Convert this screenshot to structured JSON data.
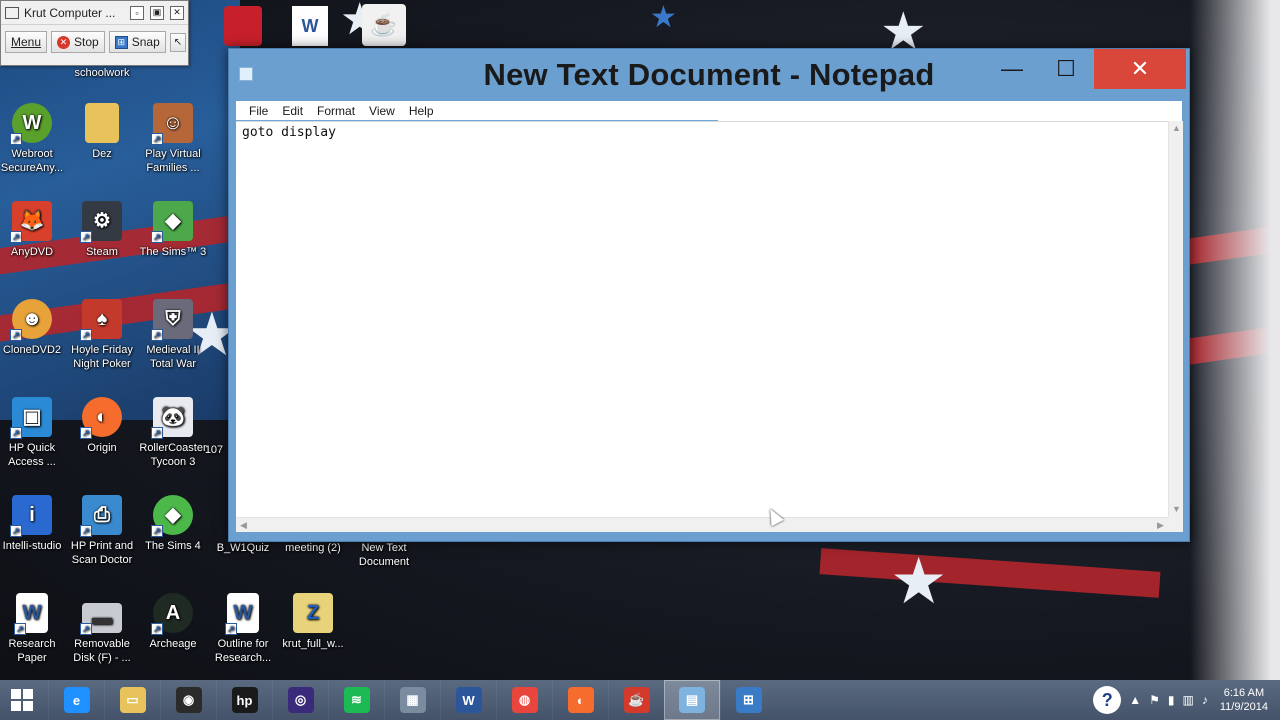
{
  "krut": {
    "title": "Krut Computer ...",
    "menu_label": "Menu",
    "stop_label": "Stop",
    "snap_label": "Snap"
  },
  "desktop_icons": [
    {
      "label": "schoolwork",
      "icon": "folder-icon"
    },
    {
      "label": "Webroot SecureAny...",
      "icon": "webroot-icon"
    },
    {
      "label": "Dez",
      "icon": "folder-icon"
    },
    {
      "label": "Play Virtual Families ...",
      "icon": "virtual-families-icon"
    },
    {
      "label": "AnyDVD",
      "icon": "anydvd-icon"
    },
    {
      "label": "Steam",
      "icon": "steam-icon"
    },
    {
      "label": "The Sims™ 3",
      "icon": "sims3-icon"
    },
    {
      "label": "CloneDVD2",
      "icon": "clonedvd-icon"
    },
    {
      "label": "Hoyle Friday Night Poker",
      "icon": "hoyle-poker-icon"
    },
    {
      "label": "Medieval II Total War",
      "icon": "medieval-icon"
    },
    {
      "label": "HP Quick Access ...",
      "icon": "hp-quick-access-icon"
    },
    {
      "label": "Origin",
      "icon": "origin-icon"
    },
    {
      "label": "RollerCoaster Tycoon 3",
      "icon": "rollercoaster-icon"
    },
    {
      "label": "107",
      "icon": "partial-icon"
    },
    {
      "label": "Intelli-studio",
      "icon": "intelli-studio-icon"
    },
    {
      "label": "HP Print and Scan Doctor",
      "icon": "hp-print-scan-icon"
    },
    {
      "label": "The Sims 4",
      "icon": "sims4-icon"
    },
    {
      "label": "B_W1Quiz",
      "icon": "document-icon"
    },
    {
      "label": "meeting (2)",
      "icon": "document-icon"
    },
    {
      "label": "New Text Document",
      "icon": "text-document-icon"
    },
    {
      "label": "Research Paper",
      "icon": "word-document-icon"
    },
    {
      "label": "Removable Disk (F) - ...",
      "icon": "removable-disk-icon"
    },
    {
      "label": "Archeage",
      "icon": "archeage-icon"
    },
    {
      "label": "Outline for Research...",
      "icon": "word-document-icon"
    },
    {
      "label": "krut_full_w...",
      "icon": "zip-folder-icon"
    }
  ],
  "notepad": {
    "title": "New Text Document - Notepad",
    "menu": [
      "File",
      "Edit",
      "Format",
      "View",
      "Help"
    ],
    "content": "goto display",
    "minimize_glyph": "—",
    "maximize_glyph": "☐",
    "close_glyph": "✕"
  },
  "taskbar": {
    "items": [
      {
        "name": "internet-explorer",
        "glyph": "e",
        "color": "#1e90ff"
      },
      {
        "name": "file-explorer",
        "glyph": "▭",
        "color": "#e8c25a"
      },
      {
        "name": "media-app",
        "glyph": "◉",
        "color": "#2b2b2b"
      },
      {
        "name": "hp",
        "glyph": "hp",
        "color": "#1a1a1a"
      },
      {
        "name": "media-player",
        "glyph": "◎",
        "color": "#3b2a7a"
      },
      {
        "name": "spotify",
        "glyph": "≋",
        "color": "#1db954"
      },
      {
        "name": "calculator",
        "glyph": "▦",
        "color": "#7a8ca0"
      },
      {
        "name": "word",
        "glyph": "W",
        "color": "#2b579a"
      },
      {
        "name": "chrome",
        "glyph": "◍",
        "color": "#e8453c"
      },
      {
        "name": "origin",
        "glyph": "◐",
        "color": "#f56c2d"
      },
      {
        "name": "java",
        "glyph": "☕",
        "color": "#d33a2c"
      },
      {
        "name": "notepad",
        "glyph": "▤",
        "color": "#7fb3df"
      },
      {
        "name": "network-app",
        "glyph": "⊞",
        "color": "#3a7bc8"
      }
    ],
    "active_index": 11,
    "clock_time": "6:16 AM",
    "clock_date": "11/9/2014",
    "help_glyph": "?"
  },
  "colors": {
    "titlebar": "#6b9fd0",
    "close_button": "#d9463a",
    "taskbar": "#4b5a70"
  }
}
